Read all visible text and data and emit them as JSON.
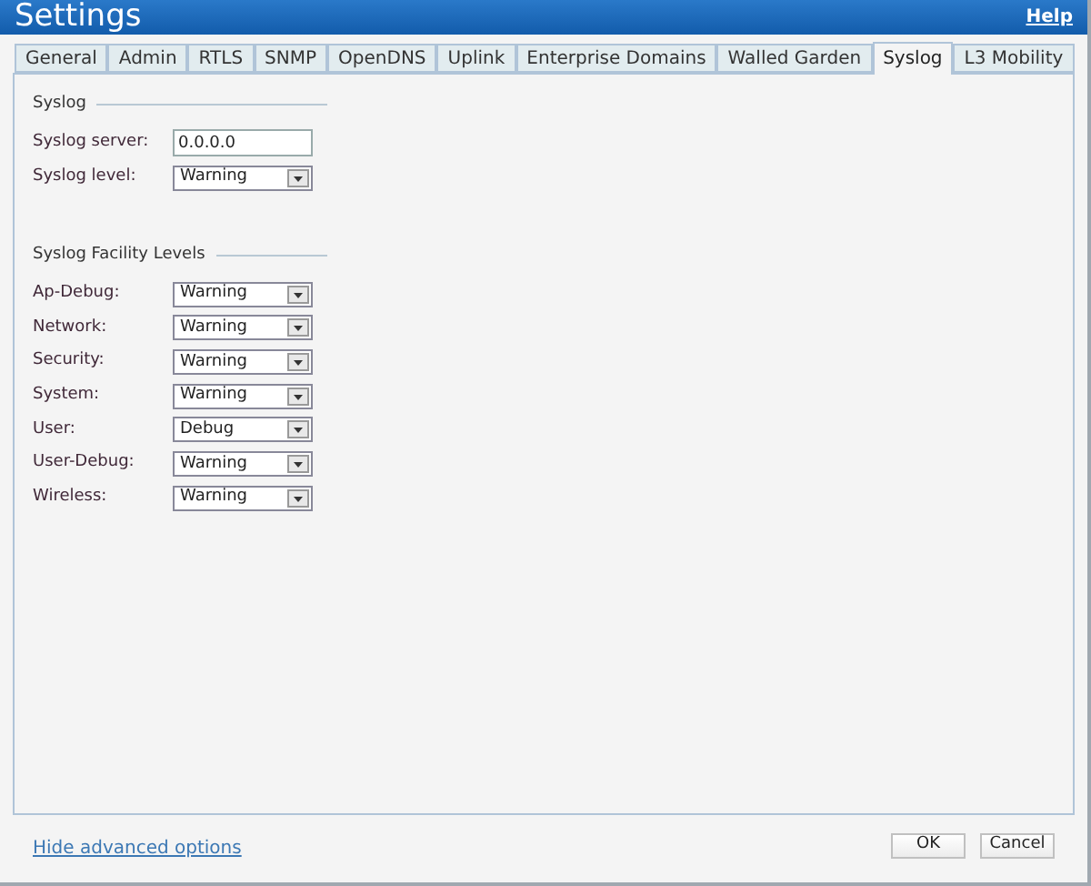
{
  "window": {
    "title": "Settings",
    "help": "Help"
  },
  "tabs": [
    {
      "label": "General",
      "selected": false
    },
    {
      "label": "Admin",
      "selected": false
    },
    {
      "label": "RTLS",
      "selected": false
    },
    {
      "label": "SNMP",
      "selected": false
    },
    {
      "label": "OpenDNS",
      "selected": false
    },
    {
      "label": "Uplink",
      "selected": false
    },
    {
      "label": "Enterprise Domains",
      "selected": false
    },
    {
      "label": "Walled Garden",
      "selected": false
    },
    {
      "label": "Syslog",
      "selected": true
    },
    {
      "label": "L3 Mobility",
      "selected": false
    }
  ],
  "sections": [
    {
      "title": "Syslog",
      "fields": [
        {
          "kind": "text",
          "label": "Syslog server:",
          "value": "0.0.0.0"
        },
        {
          "kind": "select",
          "label": "Syslog level:",
          "value": "Warning"
        }
      ]
    },
    {
      "title": "Syslog Facility Levels",
      "fields": [
        {
          "kind": "select",
          "label": "Ap-Debug:",
          "value": "Warning"
        },
        {
          "kind": "select",
          "label": "Network:",
          "value": "Warning"
        },
        {
          "kind": "select",
          "label": "Security:",
          "value": "Warning"
        },
        {
          "kind": "select",
          "label": "System:",
          "value": "Warning"
        },
        {
          "kind": "select",
          "label": "User:",
          "value": "Debug"
        },
        {
          "kind": "select",
          "label": "User-Debug:",
          "value": "Warning"
        },
        {
          "kind": "select",
          "label": "Wireless:",
          "value": "Warning"
        }
      ]
    }
  ],
  "footer": {
    "link": "Hide advanced options",
    "buttons": [
      "OK",
      "Cancel"
    ]
  }
}
